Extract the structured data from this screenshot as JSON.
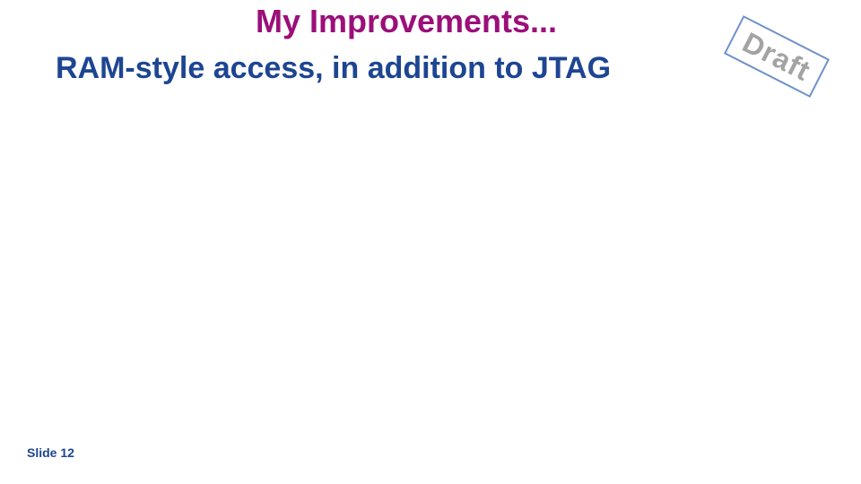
{
  "slide": {
    "title": "My Improvements...",
    "subtitle": "RAM-style access, in addition to JTAG",
    "stamp": "Draft",
    "footer": "Slide 12"
  },
  "colors": {
    "title": "#9b0f7a",
    "subtitle": "#1d4592",
    "stamp_border": "#6e91c8",
    "stamp_text": "#a3a3a3",
    "background": "#ffffff"
  }
}
